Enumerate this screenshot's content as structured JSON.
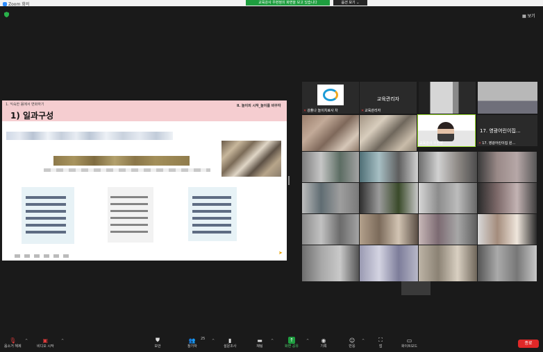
{
  "titlebar": {
    "app_title": "Zoom 회의"
  },
  "banner": {
    "share_text": "교육강사 우현정의 화면을 보고 있습니다",
    "view_options": "옵션 보기 ⌄"
  },
  "gallery_view": "▦ 보기",
  "slide": {
    "subtitle": "1. 익숙한 몸에서 변화하기",
    "right_header": "Ⅱ. 놀이의 시작_놀이를 바꾸자",
    "title": "1) 일과구성"
  },
  "participants": [
    {
      "label": "강풀나 놀이치료사 차",
      "name": ""
    },
    {
      "label": "교육관리자",
      "name": "교육관리자"
    },
    {
      "label": "",
      "name": ""
    },
    {
      "label": "",
      "name": ""
    },
    {
      "label": "",
      "name": ""
    },
    {
      "label": "",
      "name": ""
    },
    {
      "label": "교육강사 우현정",
      "name": ""
    },
    {
      "label": "17. 영광어린이집 원...",
      "name": "17. 영광어린이집..."
    }
  ],
  "toolbar": {
    "mute": "음소거 해제",
    "video": "비디오 시작",
    "security": "보안",
    "participants": "참가자",
    "participants_count": "25",
    "polls": "설문조사",
    "chat": "채팅",
    "share": "화면 공유",
    "record": "기록",
    "reactions": "반응",
    "apps": "앱",
    "whiteboard": "화이트보드",
    "end": "종료"
  },
  "colors": {
    "share_green": "#1e9e3f",
    "end_red": "#e02828",
    "slide_header_pink": "#f5cdd0",
    "active_speaker_outline": "#9be22d"
  }
}
